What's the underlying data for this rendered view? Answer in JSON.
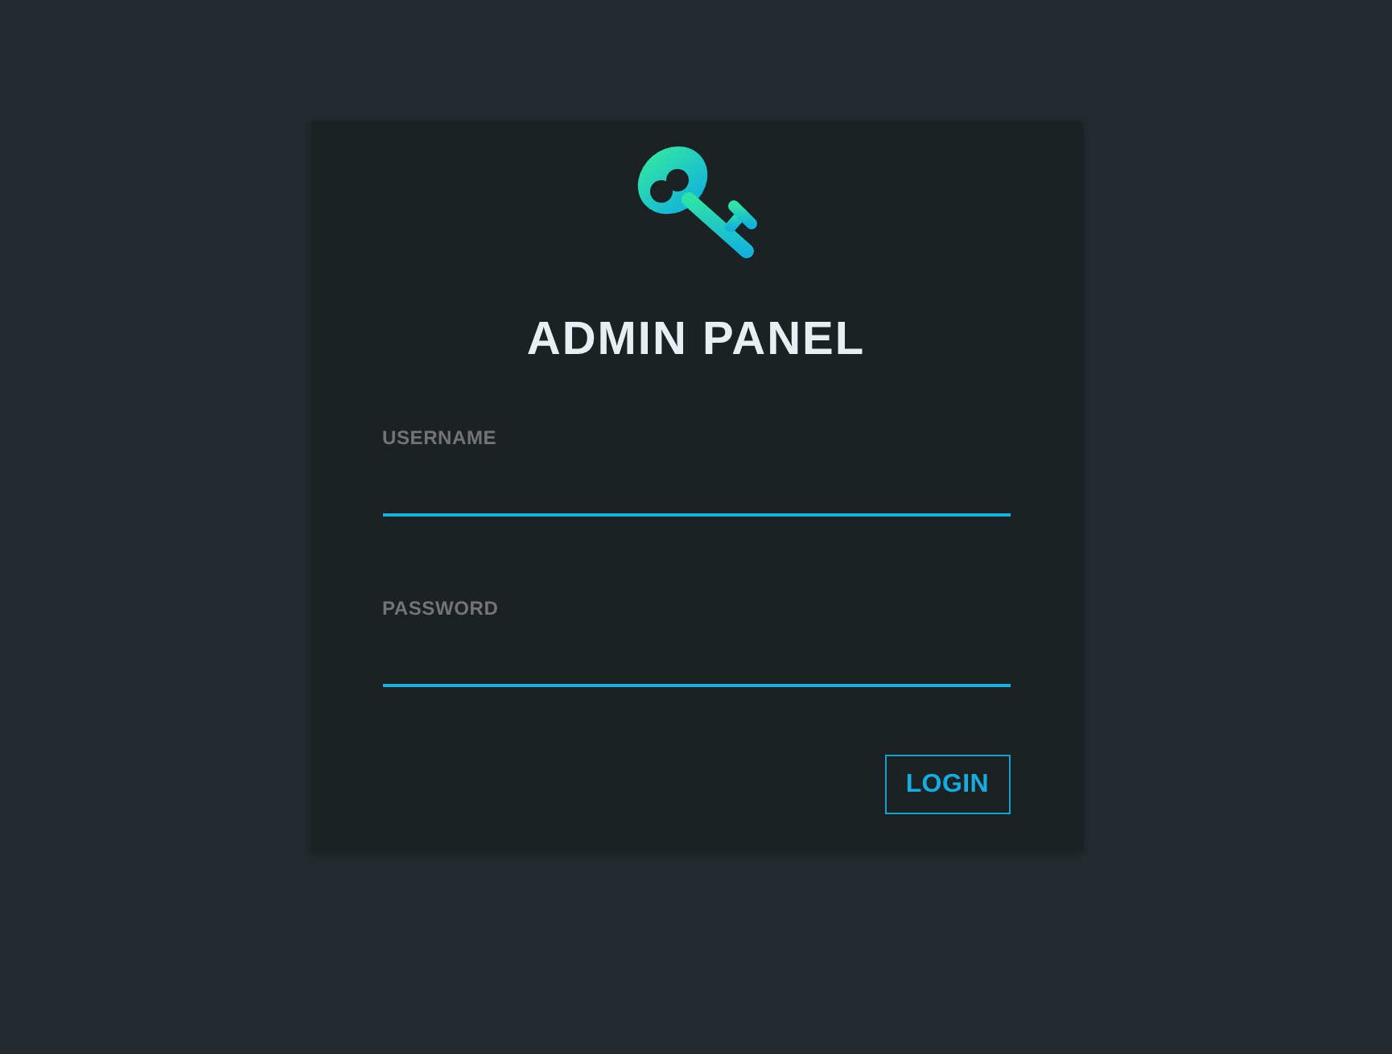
{
  "login_card": {
    "title": "ADMIN PANEL",
    "fields": [
      {
        "label": "USERNAME"
      },
      {
        "label": "PASSWORD"
      }
    ],
    "button": {
      "label": "LOGIN"
    }
  }
}
